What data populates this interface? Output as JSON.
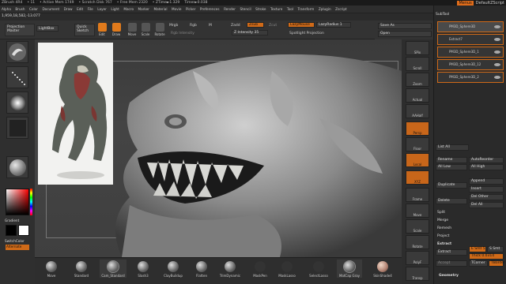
{
  "title_bar": {
    "app": "ZBrush 4R4",
    "items": [
      "• 11",
      "• Active Mem 1749",
      "• Scratch Disk 767",
      "• Free Mem 2320",
      "• ZTime►1.329",
      "Timer►0.038"
    ],
    "menus_btn": "Menus",
    "script": "DefaultZScript"
  },
  "menubar": [
    "Alpha",
    "Brush",
    "Color",
    "Document",
    "Draw",
    "Edit",
    "File",
    "Layer",
    "Light",
    "Macro",
    "Marker",
    "Material",
    "Movie",
    "Picker",
    "Preferences",
    "Render",
    "Stencil",
    "Stroke",
    "Texture",
    "Tool",
    "Transform",
    "Zplugin",
    "Zscript"
  ],
  "coordinates": "1,959,18,582,-13.077",
  "toolbar": {
    "projection_master": "Projection Master",
    "lightbox": "LightBox",
    "quick_sketch": "Quick Sketch",
    "edit": "Edit",
    "draw": "Draw",
    "move": "Move",
    "scale": "Scale",
    "rotate": "Rotate",
    "mrgb": "Mrgb",
    "rgb": "Rgb",
    "m": "M",
    "rgb_intensity": "Rgb Intensity",
    "zadd": "Zadd",
    "zsub": "Zsub",
    "zcut": "Zcut",
    "z_intensity": "Z Intensity 35",
    "lazymouse": "LazyMouse",
    "lazyradius": "LazyRadius 1",
    "spotlight": "Spotlight Projection",
    "save_as": "Save As",
    "open": "Open"
  },
  "left_panel": {
    "gradient": "Gradient",
    "switchcolor": "SwitchColor",
    "alternate": "Alternate"
  },
  "right_shelf": [
    "SPix",
    "Scroll",
    "Zoom",
    "Actual",
    "AAHalf",
    "Persp",
    "Floor",
    "Local",
    "XYZ",
    "Frame",
    "Move",
    "Scale",
    "Rotate",
    "PolyF",
    "Transp"
  ],
  "subtool": {
    "header": "SubTool",
    "items": [
      "PM3D_Sphere3D",
      "Extract7",
      "PM3D_Sphere3D_1",
      "PM3D_Sphere3D_12",
      "PM3D_Sphere3D_2"
    ],
    "list_all": "List All",
    "rename": "Rename",
    "autoreorder": "AutoReorder",
    "all_low": "All Low",
    "all_high": "All High",
    "duplicate": "Duplicate",
    "append": "Append",
    "insert": "Insert",
    "delete": "Delete",
    "del_other": "Del Other",
    "del_all": "Del All",
    "split": "Split",
    "merge": "Merge",
    "remesh": "Remesh",
    "project": "Project",
    "extract_label": "Extract",
    "extract_btn": "Extract",
    "e_smt": "E Smt 5",
    "s_smt": "S Smt",
    "thick": "Thick 0.0314",
    "accept": "Accept",
    "tcorner": "TCorner",
    "tborder": "TBorder",
    "geometry": "Geometry"
  },
  "brushes": [
    "Move",
    "Standard",
    "Cam_Standard",
    "Slash3",
    "ClayBuildup",
    "Flatten",
    "TrimDynamic",
    "MaskPen",
    "MaskLasso",
    "SelectLasso",
    "MatCap Gray",
    "SkinShade4"
  ],
  "colors": {
    "accent": "#d06a18",
    "bg": "#2b2b2b",
    "model": "#8a8a8a"
  }
}
